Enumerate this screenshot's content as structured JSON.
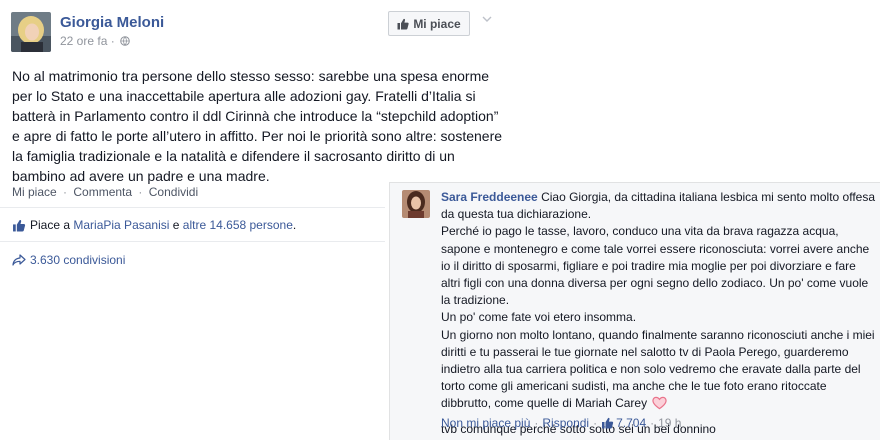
{
  "post": {
    "author": "Giorgia Meloni",
    "time": "22 ore fa",
    "time_sep": "·",
    "like_page_label": "Mi piace",
    "text": "No al matrimonio tra persone dello stesso sesso: sarebbe una spesa enorme per lo Stato e una inaccettabile apertura alle adozioni gay. Fratelli d’Italia si batterà in Parlamento contro il ddl Cirinnà che introduce la “stepchild adoption” e apre di fatto le porte all’utero in affitto. Per noi le priorità sono altre: sostenere la famiglia tradizionale e la natalità e difendere il sacrosanto diritto di un bambino ad avere un padre e una madre.",
    "actions": {
      "like": "Mi piace",
      "comment": "Commenta",
      "share": "Condividi",
      "sep": "·"
    },
    "likes": {
      "prefix": "Piace a",
      "friend": "MariaPia Pasanisi",
      "and": "e",
      "others": "altre 14.658 persone",
      "suffix": "."
    },
    "shares": "3.630 condivisioni"
  },
  "comment": {
    "author": "Sara Freddeenee",
    "lines": [
      "Ciao Giorgia, da cittadina italiana lesbica mi sento molto offesa da questa tua dichiarazione.",
      "Perché io pago le tasse, lavoro, conduco una vita da brava ragazza acqua, sapone e montenegro e come tale vorrei essere riconosciuta: vorrei avere anche io il diritto di sposarmi, figliare e poi tradire mia moglie per poi divorziare e fare altri figli con una donna diversa per ogni segno dello zodiaco. Un po' come vuole la tradizione.",
      "Un po' come fate voi etero insomma.",
      "Un giorno non molto lontano, quando finalmente saranno riconosciuti anche i miei diritti e tu passerai le tue giornate nel salotto tv di Paola Perego, guarderemo indietro alla tua carriera politica e non solo vedremo che eravate dalla parte del torto come gli americani sudisti, ma anche che le tue foto erano ritoccate dibbrutto, come quelle di Mariah Carey"
    ],
    "closing": "tvb comunque perché sotto sotto sei un bel donnino",
    "actions": {
      "unlike": "Non mi piace più",
      "reply": "Rispondi",
      "likes": "7.704",
      "time": "19 h",
      "sep": "·"
    }
  },
  "colors": {
    "link": "#3b5998",
    "muted": "#90949c",
    "heart": "#e9738b"
  },
  "icons": [
    "avatar",
    "globe-icon",
    "thumbs-up-icon",
    "chevron-down-icon",
    "share-arrow-icon",
    "heart-icon"
  ]
}
